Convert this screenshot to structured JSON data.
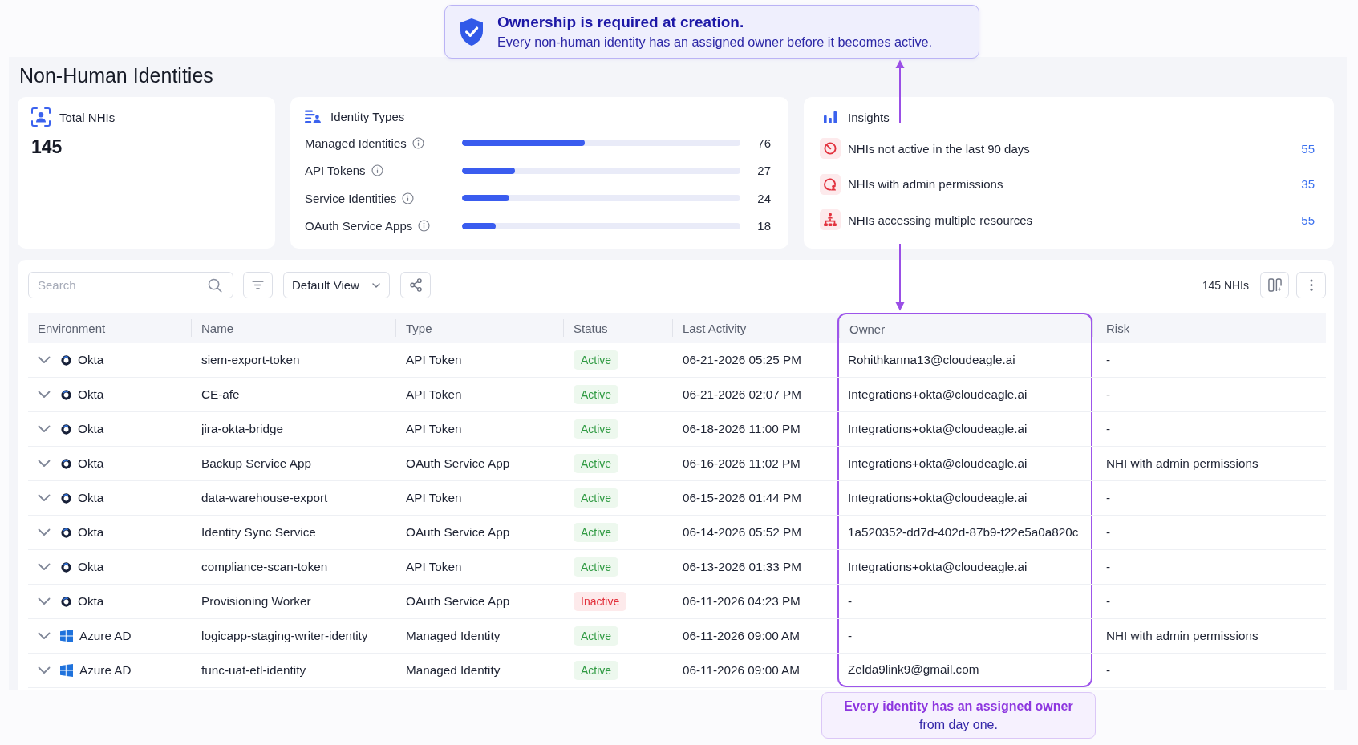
{
  "callout_top": {
    "title": "Ownership is required at creation.",
    "text": "Every non-human identity has an assigned owner before it becomes active."
  },
  "page": {
    "title": "Non-Human Identities"
  },
  "total_card": {
    "label": "Total NHIs",
    "value": "145"
  },
  "identity_types": {
    "title": "Identity Types",
    "items": [
      {
        "label": "Managed Identities",
        "level": 0.44,
        "count": "76"
      },
      {
        "label": "API Tokens",
        "level": 0.19,
        "count": "27"
      },
      {
        "label": "Service Identities",
        "level": 0.17,
        "count": "24"
      },
      {
        "label": "OAuth Service Apps",
        "level": 0.12,
        "count": "18"
      }
    ]
  },
  "insights": {
    "title": "Insights",
    "items": [
      {
        "kind": "inactive",
        "label": "NHIs not active in the last 90 days",
        "count": "55"
      },
      {
        "kind": "admin",
        "label": "NHIs with admin permissions",
        "count": "35"
      },
      {
        "kind": "resources",
        "label": "NHIs accessing multiple resources",
        "count": "55"
      }
    ]
  },
  "toolbar": {
    "search": {
      "placeholder": "Search"
    },
    "view": "Default View",
    "count": "145 NHIs"
  },
  "table": {
    "columns": [
      {
        "label": "Environment",
        "highlighted": false
      },
      {
        "label": "Name",
        "highlighted": false
      },
      {
        "label": "Type",
        "highlighted": false
      },
      {
        "label": "Status",
        "highlighted": false
      },
      {
        "label": "Last Activity",
        "highlighted": false
      },
      {
        "label": "Owner",
        "highlighted": true
      },
      {
        "label": "Risk",
        "highlighted": false
      }
    ],
    "rows": [
      {
        "environment": {
          "kind": "okta",
          "label": "Okta"
        },
        "name": "siem-export-token",
        "type": "API Token",
        "status": {
          "kind": "active",
          "label": "Active"
        },
        "last_activity": "06-21-2026 05:25 PM",
        "owner": "Rohithkanna13@cloudeagle.ai",
        "risk": "-"
      },
      {
        "environment": {
          "kind": "okta",
          "label": "Okta"
        },
        "name": "CE-afe",
        "type": "API Token",
        "status": {
          "kind": "active",
          "label": "Active"
        },
        "last_activity": "06-21-2026 02:07 PM",
        "owner": "Integrations+okta@cloudeagle.ai",
        "risk": "-"
      },
      {
        "environment": {
          "kind": "okta",
          "label": "Okta"
        },
        "name": "jira-okta-bridge",
        "type": "API Token",
        "status": {
          "kind": "active",
          "label": "Active"
        },
        "last_activity": "06-18-2026 11:00 PM",
        "owner": "Integrations+okta@cloudeagle.ai",
        "risk": "-"
      },
      {
        "environment": {
          "kind": "okta",
          "label": "Okta"
        },
        "name": "Backup Service App",
        "type": "OAuth Service App",
        "status": {
          "kind": "active",
          "label": "Active"
        },
        "last_activity": "06-16-2026 11:02 PM",
        "owner": "Integrations+okta@cloudeagle.ai",
        "risk": "NHI with admin permissions"
      },
      {
        "environment": {
          "kind": "okta",
          "label": "Okta"
        },
        "name": "data-warehouse-export",
        "type": "API Token",
        "status": {
          "kind": "active",
          "label": "Active"
        },
        "last_activity": "06-15-2026 01:44 PM",
        "owner": "Integrations+okta@cloudeagle.ai",
        "risk": "-"
      },
      {
        "environment": {
          "kind": "okta",
          "label": "Okta"
        },
        "name": "Identity Sync Service",
        "type": "OAuth Service App",
        "status": {
          "kind": "active",
          "label": "Active"
        },
        "last_activity": "06-14-2026 05:52 PM",
        "owner": "1a520352-dd7d-402d-87b9-f22e5a0a820c",
        "risk": "-"
      },
      {
        "environment": {
          "kind": "okta",
          "label": "Okta"
        },
        "name": "compliance-scan-token",
        "type": "API Token",
        "status": {
          "kind": "active",
          "label": "Active"
        },
        "last_activity": "06-13-2026 01:33 PM",
        "owner": "Integrations+okta@cloudeagle.ai",
        "risk": "-"
      },
      {
        "environment": {
          "kind": "okta",
          "label": "Okta"
        },
        "name": "Provisioning Worker",
        "type": "OAuth Service App",
        "status": {
          "kind": "inactive",
          "label": "Inactive"
        },
        "last_activity": "06-11-2026 04:23 PM",
        "owner": "-",
        "risk": "-"
      },
      {
        "environment": {
          "kind": "azure",
          "label": "Azure AD"
        },
        "name": "logicapp-staging-writer-identity",
        "type": "Managed Identity",
        "status": {
          "kind": "active",
          "label": "Active"
        },
        "last_activity": "06-11-2026 09:00 AM",
        "owner": "-",
        "risk": "NHI with admin permissions"
      },
      {
        "environment": {
          "kind": "azure",
          "label": "Azure AD"
        },
        "name": "func-uat-etl-identity",
        "type": "Managed Identity",
        "status": {
          "kind": "active",
          "label": "Active"
        },
        "last_activity": "06-11-2026 09:00 AM",
        "owner": "Zelda9link9@gmail.com",
        "risk": "-"
      }
    ]
  },
  "callout_bottom": {
    "text": "**Every identity has an assigned owner** from day one."
  }
}
